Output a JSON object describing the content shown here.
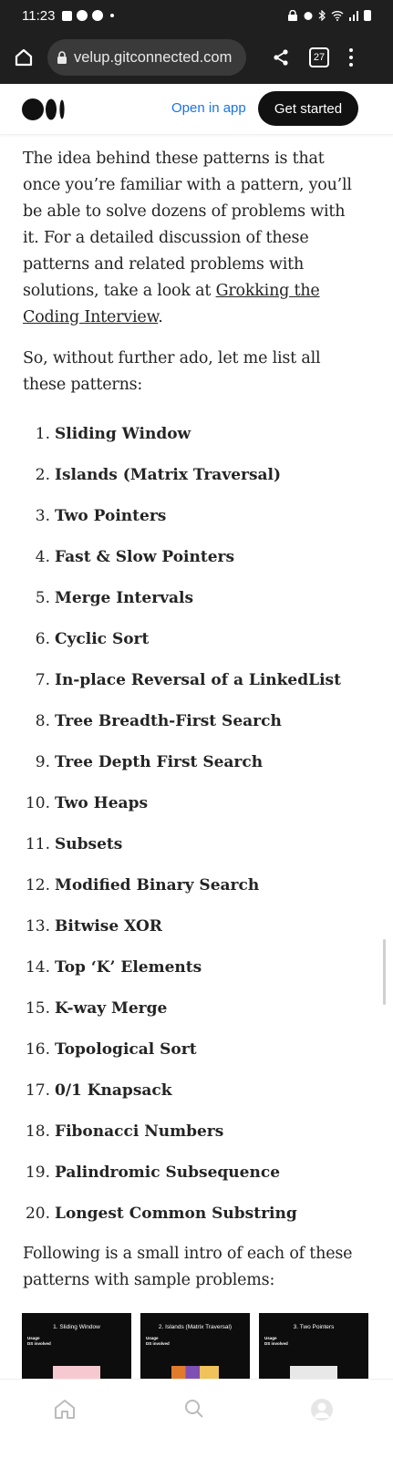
{
  "status_bar": {
    "time": "11:23"
  },
  "browser": {
    "url": "velup.gitconnected.com",
    "tab_count": "27"
  },
  "header": {
    "open_in_app": "Open in app",
    "get_started": "Get started"
  },
  "article": {
    "intro": "The idea behind these patterns is that once you’re familiar with a pattern, you’ll be able to solve dozens of problems with it. For a detailed discussion of these patterns and related problems with solutions, take a look at ",
    "intro_link": "Grokking the Coding Interview",
    "intro_end": ".",
    "lead": "So, without further ado, let me list all these patterns:",
    "patterns": [
      {
        "num": "1.",
        "name": "Sliding Window"
      },
      {
        "num": "2.",
        "name": "Islands (Matrix Traversal)"
      },
      {
        "num": "3.",
        "name": "Two Pointers"
      },
      {
        "num": "4.",
        "name": "Fast & Slow Pointers"
      },
      {
        "num": "5.",
        "name": "Merge Intervals"
      },
      {
        "num": "6.",
        "name": "Cyclic Sort"
      },
      {
        "num": "7.",
        "name": "In-place Reversal of a LinkedList"
      },
      {
        "num": "8.",
        "name": "Tree Breadth-First Search"
      },
      {
        "num": "9.",
        "name": "Tree Depth First Search"
      },
      {
        "num": "10.",
        "name": "Two Heaps"
      },
      {
        "num": "11.",
        "name": "Subsets"
      },
      {
        "num": "12.",
        "name": "Modified Binary Search"
      },
      {
        "num": "13.",
        "name": "Bitwise XOR"
      },
      {
        "num": "14.",
        "name": "Top ‘K’ Elements"
      },
      {
        "num": "15.",
        "name": "K-way Merge"
      },
      {
        "num": "16.",
        "name": "Topological Sort"
      },
      {
        "num": "17.",
        "name": "0/1 Knapsack"
      },
      {
        "num": "18.",
        "name": "Fibonacci Numbers"
      },
      {
        "num": "19.",
        "name": "Palindromic Subsequence"
      },
      {
        "num": "20.",
        "name": "Longest Common Substring"
      }
    ],
    "outro": "Following is a small intro of each of these patterns with sample problems:"
  },
  "thumbnails": [
    {
      "title": "1. Sliding Window",
      "usage_label": "Usage",
      "ds_label": "DS involved"
    },
    {
      "title": "2. Islands (Matrix Traversal)",
      "usage_label": "Usage",
      "ds_label": "DS involved"
    },
    {
      "title": "3. Two Pointers",
      "usage_label": "Usage",
      "ds_label": "DS involved"
    }
  ]
}
